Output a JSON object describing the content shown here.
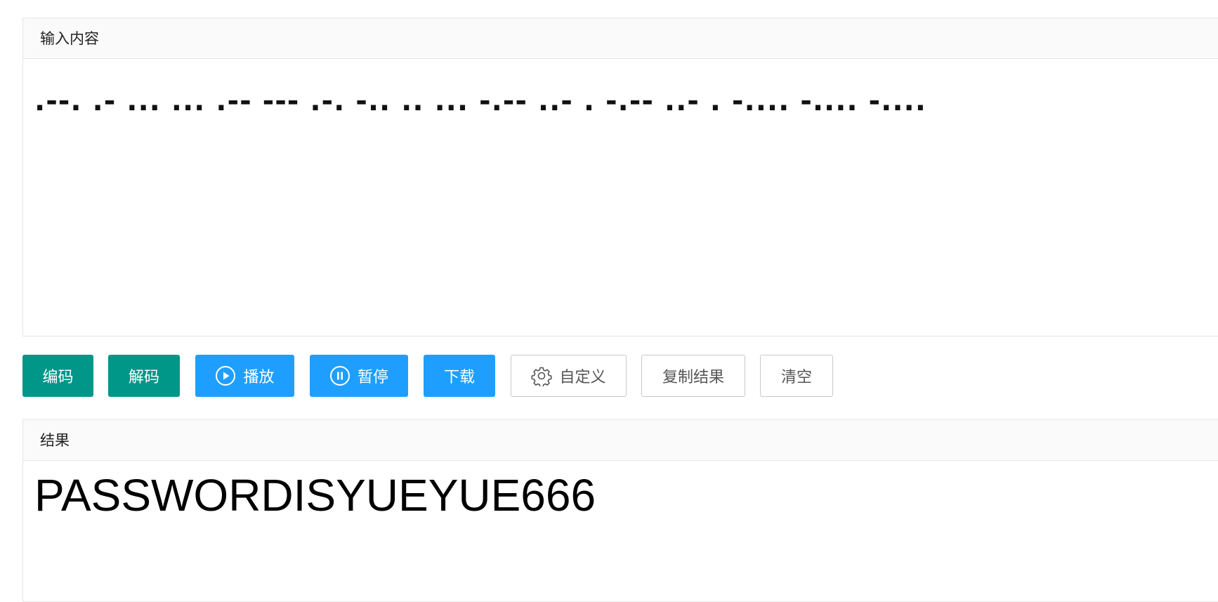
{
  "input_panel": {
    "title": "输入内容",
    "value": ".--. .- ... ... .-- --- .-. -.. .. ... -.-- ..- . -.-- ..- . -.... -.... -...."
  },
  "toolbar": {
    "encode_label": "编码",
    "decode_label": "解码",
    "play_label": "播放",
    "pause_label": "暂停",
    "download_label": "下载",
    "custom_label": "自定义",
    "copy_label": "复制结果",
    "clear_label": "清空",
    "play_icon": "play-circle-icon",
    "pause_icon": "pause-circle-icon",
    "custom_icon": "gear-icon"
  },
  "result_panel": {
    "title": "结果",
    "value": "PASSWORDISYUEYUE666"
  },
  "colors": {
    "green": "#009688",
    "blue": "#1e9fff",
    "border": "#e6e6e6",
    "header_bg": "#fafafa"
  }
}
